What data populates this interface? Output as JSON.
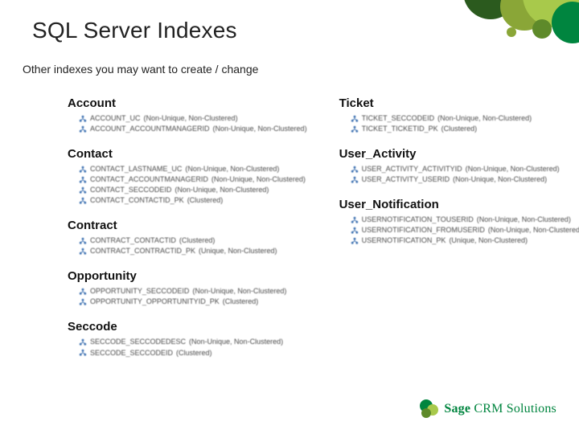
{
  "title": "SQL Server Indexes",
  "subtitle": "Other indexes you may want to create / change",
  "colors": {
    "brand": "#00853f",
    "accent_dark": "#2b5a1e",
    "accent_olive": "#8aa637",
    "accent_lime": "#a8c94b"
  },
  "left_sections": [
    {
      "heading": "Account",
      "indexes": [
        {
          "name": "ACCOUNT_UC",
          "props": "(Non-Unique, Non-Clustered)"
        },
        {
          "name": "ACCOUNT_ACCOUNTMANAGERID",
          "props": "(Non-Unique, Non-Clustered)"
        }
      ]
    },
    {
      "heading": "Contact",
      "indexes": [
        {
          "name": "CONTACT_LASTNAME_UC",
          "props": "(Non-Unique, Non-Clustered)"
        },
        {
          "name": "CONTACT_ACCOUNTMANAGERID",
          "props": "(Non-Unique, Non-Clustered)"
        },
        {
          "name": "CONTACT_SECCODEID",
          "props": "(Non-Unique, Non-Clustered)"
        },
        {
          "name": "CONTACT_CONTACTID_PK",
          "props": "(Clustered)"
        }
      ]
    },
    {
      "heading": "Contract",
      "indexes": [
        {
          "name": "CONTRACT_CONTACTID",
          "props": "(Clustered)"
        },
        {
          "name": "CONTRACT_CONTRACTID_PK",
          "props": "(Unique, Non-Clustered)"
        }
      ]
    },
    {
      "heading": "Opportunity",
      "indexes": [
        {
          "name": "OPPORTUNITY_SECCODEID",
          "props": "(Non-Unique, Non-Clustered)"
        },
        {
          "name": "OPPORTUNITY_OPPORTUNITYID_PK",
          "props": "(Clustered)"
        }
      ]
    },
    {
      "heading": "Seccode",
      "indexes": [
        {
          "name": "SECCODE_SECCODEDESC",
          "props": "(Non-Unique, Non-Clustered)"
        },
        {
          "name": "SECCODE_SECCODEID",
          "props": "(Clustered)"
        }
      ]
    }
  ],
  "right_sections": [
    {
      "heading": "Ticket",
      "indexes": [
        {
          "name": "TICKET_SECCODEID",
          "props": "(Non-Unique, Non-Clustered)"
        },
        {
          "name": "TICKET_TICKETID_PK",
          "props": "(Clustered)"
        }
      ]
    },
    {
      "heading": "User_Activity",
      "indexes": [
        {
          "name": "USER_ACTIVITY_ACTIVITYID",
          "props": "(Non-Unique, Non-Clustered)"
        },
        {
          "name": "USER_ACTIVITY_USERID",
          "props": "(Non-Unique, Non-Clustered)"
        }
      ]
    },
    {
      "heading": "User_Notification",
      "indexes": [
        {
          "name": "USERNOTIFICATION_TOUSERID",
          "props": "(Non-Unique, Non-Clustered)"
        },
        {
          "name": "USERNOTIFICATION_FROMUSERID",
          "props": "(Non-Unique, Non-Clustered)"
        },
        {
          "name": "USERNOTIFICATION_PK",
          "props": "(Unique, Non-Clustered)"
        }
      ]
    }
  ],
  "footer": {
    "brand_strong": "Sage",
    "brand_rest": " CRM Solutions"
  }
}
